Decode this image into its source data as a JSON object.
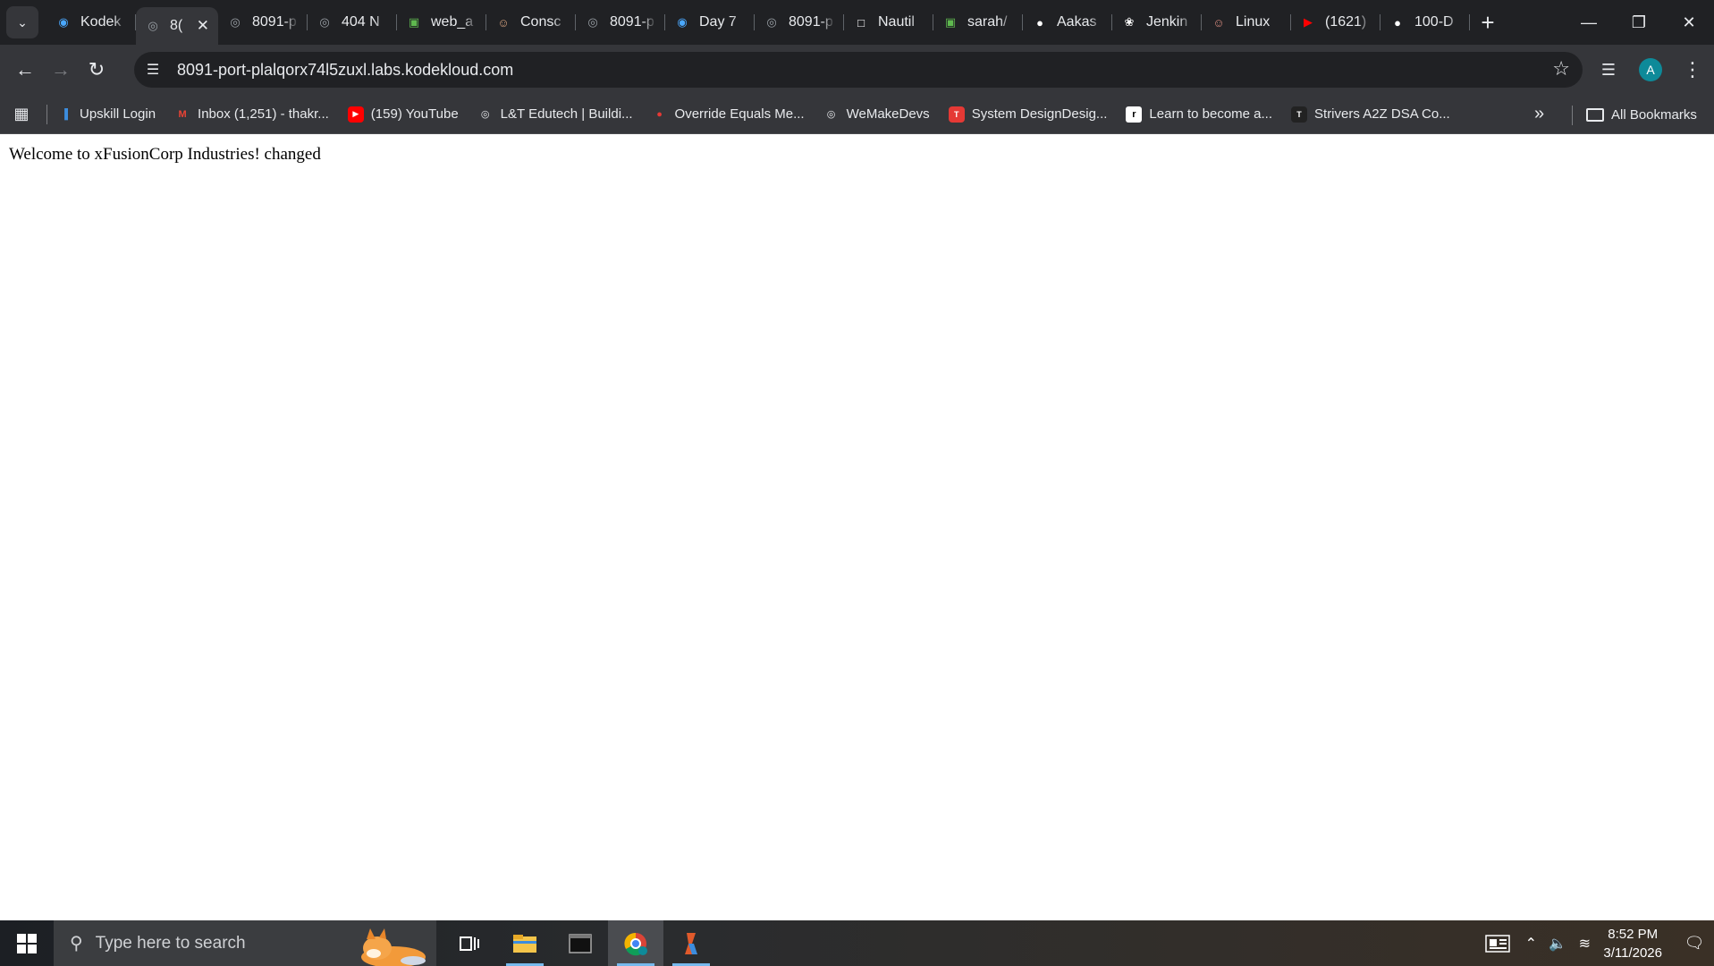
{
  "tabs": [
    {
      "title": "Kodek",
      "favicon": "kodekloud-icon",
      "color": "#4aa8ff"
    },
    {
      "title": "8(",
      "favicon": "globe-icon",
      "color": "#9aa0a6",
      "active": true
    },
    {
      "title": "8091-p",
      "favicon": "globe-icon",
      "color": "#9aa0a6"
    },
    {
      "title": "404 N",
      "favicon": "globe-icon",
      "color": "#9aa0a6"
    },
    {
      "title": "web_a",
      "favicon": "money-icon",
      "color": "#5fb84f"
    },
    {
      "title": "Consc",
      "favicon": "avatar-icon",
      "color": "#d8a47f"
    },
    {
      "title": "8091-p",
      "favicon": "globe-icon",
      "color": "#9aa0a6"
    },
    {
      "title": "Day 7",
      "favicon": "kodekloud-icon",
      "color": "#4aa8ff"
    },
    {
      "title": "8091-p",
      "favicon": "globe-icon",
      "color": "#9aa0a6"
    },
    {
      "title": "Nautil",
      "favicon": "page-icon",
      "color": "#ffffff"
    },
    {
      "title": "sarah/",
      "favicon": "money-icon",
      "color": "#5fb84f"
    },
    {
      "title": "Aakas",
      "favicon": "github-icon",
      "color": "#ffffff"
    },
    {
      "title": "Jenkin",
      "favicon": "openai-icon",
      "color": "#ffffff"
    },
    {
      "title": "Linux",
      "favicon": "avatar-icon",
      "color": "#d88b7f"
    },
    {
      "title": "(1621)",
      "favicon": "youtube-icon",
      "color": "#ff0000"
    },
    {
      "title": "100-D",
      "favicon": "github-icon",
      "color": "#ffffff"
    }
  ],
  "address_bar": {
    "url": "8091-port-plalqorx74l5zuxl.labs.kodekloud.com"
  },
  "profile": {
    "initial": "A"
  },
  "bookmarks": [
    {
      "label": "Upskill Login",
      "icon": "chart-icon",
      "color": "#3c8dde"
    },
    {
      "label": "Inbox (1,251) - thakr...",
      "icon": "gmail-icon",
      "color": "#ea4335"
    },
    {
      "label": "(159) YouTube",
      "icon": "youtube-icon",
      "color": "#ff0000"
    },
    {
      "label": "L&T Edutech | Buildi...",
      "icon": "globe-icon",
      "color": "#e8eaed"
    },
    {
      "label": "Override Equals Me...",
      "icon": "dot-icon",
      "color": "#e53935"
    },
    {
      "label": "WeMakeDevs",
      "icon": "globe-icon",
      "color": "#e8eaed"
    },
    {
      "label": "System DesignDesig...",
      "icon": "tuf-icon",
      "color": "#e53935"
    },
    {
      "label": "Learn to become a...",
      "icon": "roadmap-icon",
      "color": "#ffffff"
    },
    {
      "label": "Strivers A2Z DSA Co...",
      "icon": "tuf-icon",
      "color": "#222222"
    }
  ],
  "all_bookmarks_label": "All Bookmarks",
  "page": {
    "text": "Welcome to xFusionCorp Industries! changed"
  },
  "taskbar": {
    "search_placeholder": "Type here to search",
    "time": "8:52 PM",
    "date": "3/11/2026"
  }
}
